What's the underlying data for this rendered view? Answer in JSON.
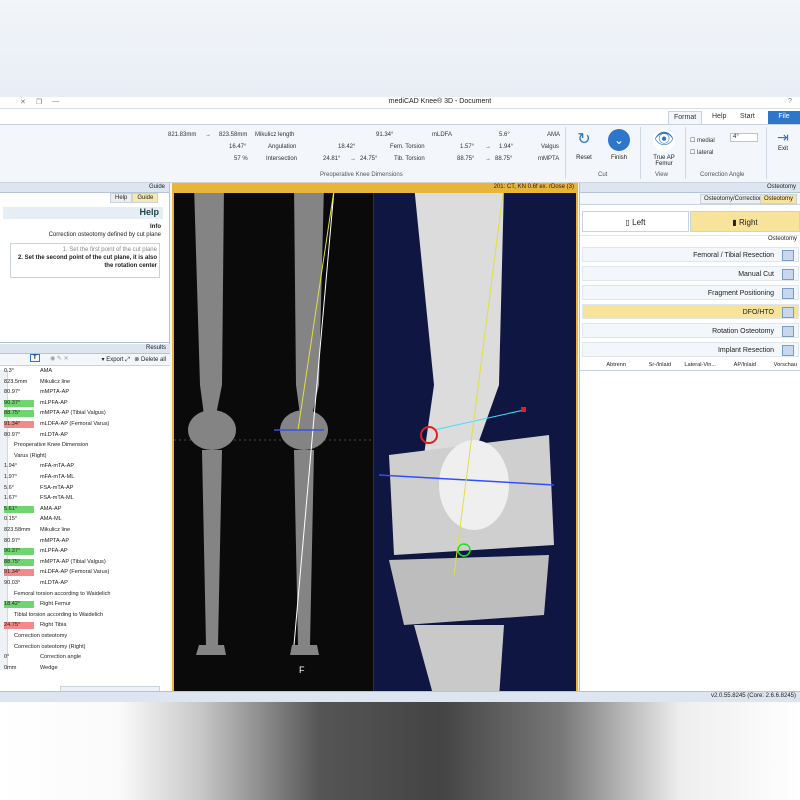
{
  "window": {
    "title": "mediCAD Knee® 3D - Document"
  },
  "menu_tabs": [
    "File",
    "Start",
    "Help",
    "Format"
  ],
  "ribbon": {
    "exit": "Exit",
    "correction_angle": {
      "value": "4°",
      "medial": "medial",
      "lateral": "lateral",
      "group": "Correction Angle"
    },
    "view": {
      "true_ap_femur": "True AP Femur",
      "view_label": "View"
    },
    "cut": {
      "finish": "Finish",
      "reset": "Reset",
      "cut_label": "Cut"
    },
    "dims_group": "Preoperative Knee Dimensions",
    "dims": [
      [
        "AMA",
        "5.6°",
        "mLDFA",
        "91.34°",
        "Mikulicz length",
        "823.58mm",
        "→",
        "821.83mm"
      ],
      [
        "Valgus",
        "1.94°",
        "→",
        "1.57°",
        "Fem. Torsion",
        "18.42°",
        "Angulation",
        "16.47°"
      ],
      [
        "mMPTA",
        "88.75°",
        "→",
        "88.75°",
        "Tib. Torsion",
        "24.75°",
        "→",
        "24.81°",
        "Intersection",
        "57 %"
      ]
    ]
  },
  "guide": {
    "header": "Guide",
    "tabs": [
      "Help",
      "Guide"
    ],
    "title": "Help",
    "info_head": "Info",
    "info": "Correction osteotomy defined by cut plane",
    "steps": [
      "1. Set the first point of the cut plane",
      "2. Set the second point of the cut plane, it is also the rotation center"
    ]
  },
  "results": {
    "header": "Results",
    "delete_all": "Delete all",
    "export": "Export",
    "rows": [
      {
        "v": "0.3°",
        "l": "AMA",
        "c": ""
      },
      {
        "v": "823.5mm",
        "l": "Mikulicz line",
        "c": ""
      },
      {
        "v": "80.97°",
        "l": "mMPTA-AP",
        "c": ""
      },
      {
        "v": "90.37°",
        "l": "mLPFA-AP",
        "c": "g"
      },
      {
        "v": "88.75°",
        "l": "mMPTA-AP (Tibial Valgus)",
        "c": "g"
      },
      {
        "v": "91.34°",
        "l": "mLDFA-AP (Femoral Varus)",
        "c": "r"
      },
      {
        "v": "80.97°",
        "l": "mLDTA-AP",
        "c": ""
      },
      {
        "v": "",
        "l": "Preoperative Knee Dimension",
        "c": ""
      },
      {
        "v": "",
        "l": "Varus (Right)",
        "c": ""
      },
      {
        "v": "1.94°",
        "l": "mFA-mTA-AP",
        "c": ""
      },
      {
        "v": "1.97°",
        "l": "mFA-mTA-ML",
        "c": ""
      },
      {
        "v": "5.6°",
        "l": "FSA-mTA-AP",
        "c": ""
      },
      {
        "v": "1.67°",
        "l": "FSA-mTA-ML",
        "c": ""
      },
      {
        "v": "5.61°",
        "l": "AMA-AP",
        "c": "g"
      },
      {
        "v": "0.15°",
        "l": "AMA-ML",
        "c": ""
      },
      {
        "v": "823.58mm",
        "l": "Mikulicz line",
        "c": ""
      },
      {
        "v": "80.97°",
        "l": "mMPTA-AP",
        "c": ""
      },
      {
        "v": "90.37°",
        "l": "mLPFA-AP",
        "c": "g"
      },
      {
        "v": "88.75°",
        "l": "mMPTA-AP (Tibial Valgus)",
        "c": "g"
      },
      {
        "v": "91.34°",
        "l": "mLDFA-AP (Femoral Varus)",
        "c": "r"
      },
      {
        "v": "90.03°",
        "l": "mLDTA-AP",
        "c": ""
      },
      {
        "v": "",
        "l": "Femoral torsion according to Waidelich",
        "c": ""
      },
      {
        "v": "18.42°",
        "l": "Right Femur",
        "c": "g"
      },
      {
        "v": "",
        "l": "Tibial torsion according to Waidelich",
        "c": ""
      },
      {
        "v": "24.75°",
        "l": "Right Tibia",
        "c": "r"
      },
      {
        "v": "",
        "l": "Correction osteotomy",
        "c": ""
      },
      {
        "v": "",
        "l": "Correction osteotomy (Right)",
        "c": ""
      },
      {
        "v": "0°",
        "l": "Correction angle",
        "c": ""
      },
      {
        "v": "0mm",
        "l": "Wedge",
        "c": ""
      }
    ]
  },
  "viewer": {
    "header": "201: CT, KN 0.6f ex. rDose (3)",
    "marker": "F"
  },
  "osteotomy": {
    "header": "Osteotomy",
    "tabs": [
      "Osteotomy/Correction",
      "Osteotomy"
    ],
    "right": "Right",
    "left": "Left",
    "section": "Osteotomy",
    "buttons": [
      "Femoral / Tibial Resection",
      "Manual Cut",
      "Fragment Positioning",
      "DFO/HTO",
      "Rotation Osteotomy",
      "Implant Resection"
    ],
    "columns": [
      "Vorschau",
      "AP/Inlaid",
      "Lateral-Vin...",
      "Sr-/Inlaid",
      "Abtrenn"
    ]
  },
  "status": "v2.0.55.8245 (Core: 2.6.6.8245)"
}
